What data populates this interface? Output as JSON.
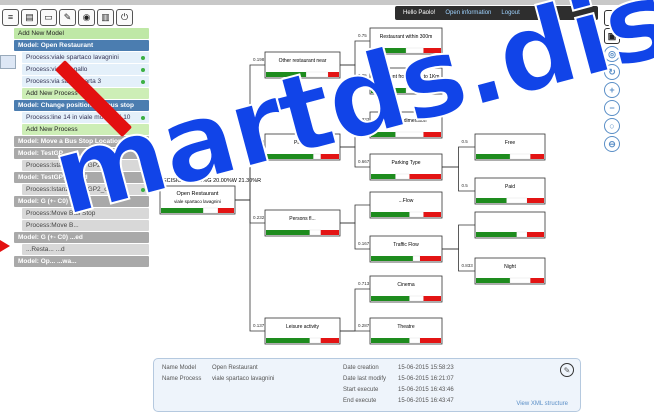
{
  "topbar": {
    "greeting": "Hello Paolo!",
    "open_info": "Open information",
    "logout": "Logout"
  },
  "sidebar": {
    "items": [
      {
        "kind": "green",
        "label": "Add New Model"
      },
      {
        "kind": "model",
        "label": "Model: Open Restaurant"
      },
      {
        "kind": "proc",
        "label": "Process:viale spartaco lavagnini",
        "dot": "#3cb043"
      },
      {
        "kind": "proc",
        "label": "Process:via san gallo",
        "dot": "#3cb043"
      },
      {
        "kind": "proc",
        "label": "Process:via santa marta 3",
        "dot": "#3cb043"
      },
      {
        "kind": "addp",
        "label": "Add New Process"
      },
      {
        "kind": "model",
        "label": "Model: Change position of a bus stop"
      },
      {
        "kind": "proc",
        "label": "Process:line 14 in viale morgagni 10",
        "dot": "#3cb043"
      },
      {
        "kind": "addp",
        "label": "Add New Process"
      },
      {
        "kind": "gray",
        "label": "Model: Move a Bus Stop Location"
      },
      {
        "kind": "gray",
        "label": "Model: TestGP"
      },
      {
        "kind": "gproc",
        "label": "Process:Istanza Test GP2",
        "dot": "#e8673a"
      },
      {
        "kind": "gray",
        "label": "Model: TestGP_cloned"
      },
      {
        "kind": "gproc",
        "label": "Process:Istanza Test GP2_cloned",
        "dot": "#3cb043"
      },
      {
        "kind": "gray",
        "label": "Model: G (+- C0)"
      },
      {
        "kind": "gproc",
        "label": "Process:Move Bus Stop"
      },
      {
        "kind": "gproc",
        "label": "Process:Move B..."
      },
      {
        "kind": "gray",
        "label": "Model: G (+- C0) ...ed"
      },
      {
        "kind": "gproc",
        "label": "...Resta... ...d"
      },
      {
        "kind": "gray",
        "label": "Model: Op... ...wa..."
      }
    ]
  },
  "tree": {
    "decision": "DECISION: 58.70%G 20.00%W 21.30%R",
    "root": {
      "title": "Open Restaurant",
      "subtitle": "viale spartaco lavagnini"
    },
    "nodes": [
      {
        "id": "other",
        "title": "Other restaurant near"
      },
      {
        "id": "parking",
        "title": "Parking"
      },
      {
        "id": "persons",
        "title": "Persons fl..."
      },
      {
        "id": "leisure",
        "title": "Leisure activity"
      },
      {
        "id": "within",
        "title": "Restaurant within 300m"
      },
      {
        "id": "from",
        "title": "Restaurant from 300m to 1Km"
      },
      {
        "id": "pdim",
        "title": "Parking dimension"
      },
      {
        "id": "ptype",
        "title": "Parking Type"
      },
      {
        "id": "pflow",
        "title": "...Flow"
      },
      {
        "id": "tflow",
        "title": "Traffic Flow"
      },
      {
        "id": "cinema",
        "title": "Cinema"
      },
      {
        "id": "theatre",
        "title": "Theatre"
      },
      {
        "id": "free",
        "title": "Free"
      },
      {
        "id": "paid",
        "title": "Paid"
      },
      {
        "id": "day",
        "title": ""
      },
      {
        "id": "night",
        "title": "Night"
      }
    ],
    "weights": {
      "other": "0.198",
      "parking": "0.665",
      "persons": "0.232",
      "leisure": "0.137",
      "within": "0.75",
      "from": "0.25",
      "pdim": "0.333",
      "ptype": "0.667",
      "free": "0.5",
      "paid": "0.5",
      "tflow": "0.167",
      "night": "0.833",
      "cinema": "0.713",
      "theatre": "0.287",
      "extra": "0.395"
    }
  },
  "info": {
    "name_model_label": "Name Model",
    "name_model_value": "Open Restaurant",
    "name_process_label": "Name Process",
    "name_process_value": "viale spartaco lavagnini",
    "date_creation_label": "Date creation",
    "date_creation_value": "15-06-2015 15:58:23",
    "date_modify_label": "Date last modify",
    "date_modify_value": "15-06-2015 16:21:07",
    "start_exec_label": "Start execute",
    "start_exec_value": "15-06-2015 16:43:46",
    "end_exec_label": "End execute",
    "end_exec_value": "15-06-2015 16:43:47",
    "xml_link": "View XML structure"
  },
  "watermark": "martds.disit.org",
  "colors": {
    "green": "#1e8c1e",
    "red": "#e31414",
    "white": "#ffffff",
    "accent": "#4b7db0"
  }
}
